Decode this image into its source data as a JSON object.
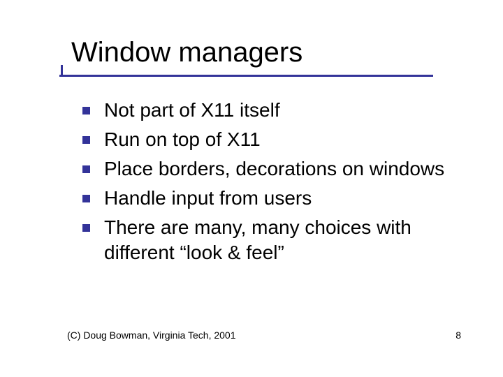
{
  "slide": {
    "title": "Window managers",
    "bullets": [
      "Not part of X11 itself",
      "Run on top of X11",
      "Place borders, decorations on windows",
      "Handle input from users",
      "There are many, many choices with different “look & feel”"
    ],
    "footer_left": "(C) Doug Bowman, Virginia Tech, 2001",
    "footer_right": "8"
  },
  "colors": {
    "accent": "#333399"
  }
}
